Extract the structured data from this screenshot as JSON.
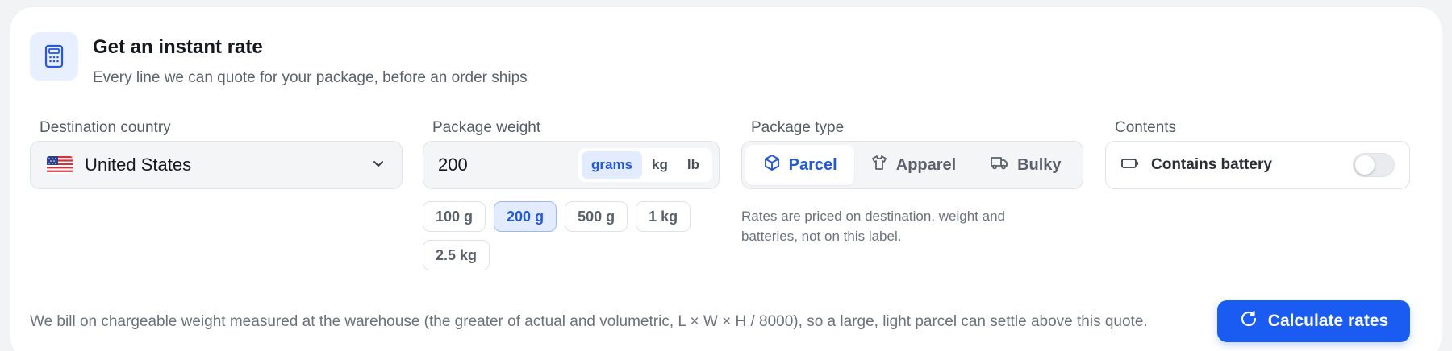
{
  "header": {
    "title": "Get an instant rate",
    "subtitle": "Every line we can quote for your package, before an order ships",
    "icon": "calculator-icon"
  },
  "destination": {
    "label": "Destination country",
    "value": "United States",
    "flag": "us-flag-icon"
  },
  "weight": {
    "label": "Package weight",
    "value": "200",
    "units": [
      "grams",
      "kg",
      "lb"
    ],
    "selected_unit": "grams",
    "presets": [
      "100 g",
      "200 g",
      "500 g",
      "1 kg",
      "2.5 kg"
    ],
    "selected_preset": "200 g"
  },
  "package_type": {
    "label": "Package type",
    "options": [
      {
        "label": "Parcel",
        "icon": "box-icon"
      },
      {
        "label": "Apparel",
        "icon": "shirt-icon"
      },
      {
        "label": "Bulky",
        "icon": "truck-icon"
      }
    ],
    "selected": "Parcel",
    "note": "Rates are priced on destination, weight and batteries, not on this label."
  },
  "contents": {
    "label": "Contents",
    "toggle_label": "Contains battery",
    "enabled": false
  },
  "footer": {
    "note": "We bill on chargeable weight measured at the warehouse (the greater of actual and volumetric, L × W × H / 8000), so a large, light parcel can settle above this quote.",
    "button": "Calculate rates"
  },
  "colors": {
    "accent": "#1a5cf2",
    "accent_soft": "#e3ecff"
  }
}
